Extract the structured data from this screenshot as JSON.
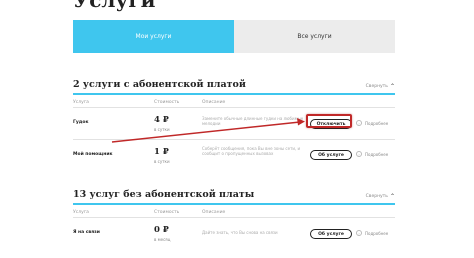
{
  "page": {
    "title": "Услуги"
  },
  "tabs": [
    {
      "label": "Мои услуги",
      "active": true
    },
    {
      "label": "Все услуги",
      "active": false
    }
  ],
  "paid": {
    "title": "2 услуги с абонентской платой",
    "collapse_label": "Свернуть",
    "columns": {
      "service": "Услуга",
      "cost": "Стоимость",
      "description": "Описание"
    },
    "rows": [
      {
        "name": "Гудок",
        "price": "4 ₽",
        "period": "в сутки",
        "description": "Замените обычные длинные гудки на любимые мелодии",
        "button": "Отключить",
        "detail": "Подробнее"
      },
      {
        "name": "Мой помощник",
        "price": "1 ₽",
        "period": "в сутки",
        "description": "Соберёт сообщения, пока Вы вне зоны сети, и сообщит о пропущенных вызовах",
        "button": "Об услуге",
        "detail": "Подробнее"
      }
    ]
  },
  "free": {
    "title": "13 услуг без абонентской платы",
    "collapse_label": "Свернуть",
    "columns": {
      "service": "Услуга",
      "cost": "Стоимость",
      "description": "Описание"
    },
    "rows": [
      {
        "name": "Я на связи",
        "price": "0 ₽",
        "period": "в месяц",
        "description": "Дайте знать, что Вы снова на связи",
        "button": "Об услуге",
        "detail": "Подробнее"
      }
    ]
  },
  "colors": {
    "accent": "#3fc6ee",
    "highlight": "#c02828"
  }
}
